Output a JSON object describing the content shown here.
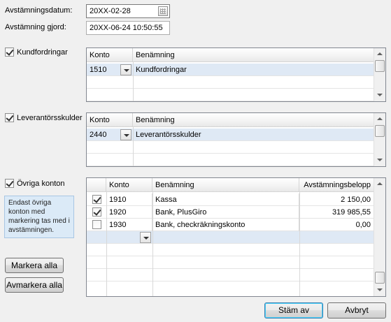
{
  "header": {
    "date_label": "Avstämningsdatum:",
    "date_value": "20XX-02-28",
    "done_label": "Avstämning gjord:",
    "done_value": "20XX-06-24  10:50:55"
  },
  "kundfordringar": {
    "label": "Kundfordringar",
    "checked": true,
    "columns": [
      "Konto",
      "Benämning"
    ],
    "rows": [
      {
        "konto": "1510",
        "benamning": "Kundfordringar"
      }
    ]
  },
  "leverantorsskulder": {
    "label": "Leverantörsskulder",
    "checked": true,
    "columns": [
      "Konto",
      "Benämning"
    ],
    "rows": [
      {
        "konto": "2440",
        "benamning": "Leverantörsskulder"
      }
    ]
  },
  "ovriga": {
    "label": "Övriga konton",
    "checked": true,
    "info": "Endast övriga konton med markering tas med i avstämningen.",
    "columns": [
      "Konto",
      "Benämning",
      "Avstämningsbelopp"
    ],
    "rows": [
      {
        "checked": true,
        "konto": "1910",
        "benamning": "Kassa",
        "belopp": "2 150,00"
      },
      {
        "checked": true,
        "konto": "1920",
        "benamning": "Bank, PlusGiro",
        "belopp": "319 985,55"
      },
      {
        "checked": false,
        "konto": "1930",
        "benamning": "Bank, checkräkningskonto",
        "belopp": "0,00"
      }
    ]
  },
  "buttons": {
    "mark_all": "Markera alla",
    "unmark_all": "Avmarkera alla",
    "reconcile": "Stäm av",
    "cancel": "Avbryt"
  },
  "icons": {
    "calendar": "calendar-icon",
    "dropdown": "chevron-down-icon",
    "scroll_up": "scroll-up-icon",
    "scroll_down": "scroll-down-icon"
  },
  "colors": {
    "selected_row": "#dfe9f5",
    "info_background": "#dbeaf7",
    "default_button_border": "#3c7fb1"
  }
}
